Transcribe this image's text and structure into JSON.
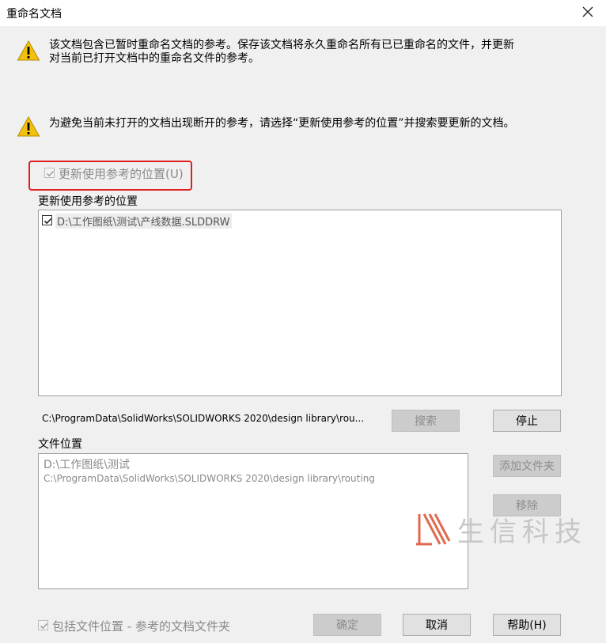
{
  "window": {
    "title": "重命名文档",
    "close_glyph": "✕"
  },
  "messages": {
    "line1": "该文档包含已暂时重命名文档的参考。保存该文档将永久重命名所有已已重命名的文件，并更新",
    "line2": "对当前已打开文档中的重命名文件的参考。",
    "line3": "为避免当前未打开的文档出现断开的参考，请选择“更新使用参考的位置”并搜索要更新的文档。"
  },
  "update_refs": {
    "checkbox_label": "更新使用参考的位置(U)",
    "checked": true,
    "list_label": "更新使用参考的位置",
    "items": [
      {
        "text": "D:\\工作图纸\\测试\\产线数据.SLDDRW",
        "checked": true
      }
    ]
  },
  "search_path": "C:\\ProgramData\\SolidWorks\\SOLIDWORKS 2020\\design library\\rou...",
  "buttons": {
    "search": "搜索",
    "stop": "停止",
    "add_folder": "添加文件夹",
    "remove": "移除",
    "ok": "确定",
    "cancel": "取消",
    "help": "帮助(H)"
  },
  "file_locations": {
    "label": "文件位置",
    "items": [
      "D:\\工作图纸\\测试",
      "C:\\ProgramData\\SolidWorks\\SOLIDWORKS 2020\\design library\\routing"
    ]
  },
  "include_checkbox": {
    "label": "包括文件位置 - 参考的文档文件夹",
    "checked": true
  },
  "watermark": {
    "text": "生信科技",
    "color": "#e06a4f"
  },
  "colors": {
    "warning": "#f3c10b",
    "highlight": "#e02020"
  }
}
